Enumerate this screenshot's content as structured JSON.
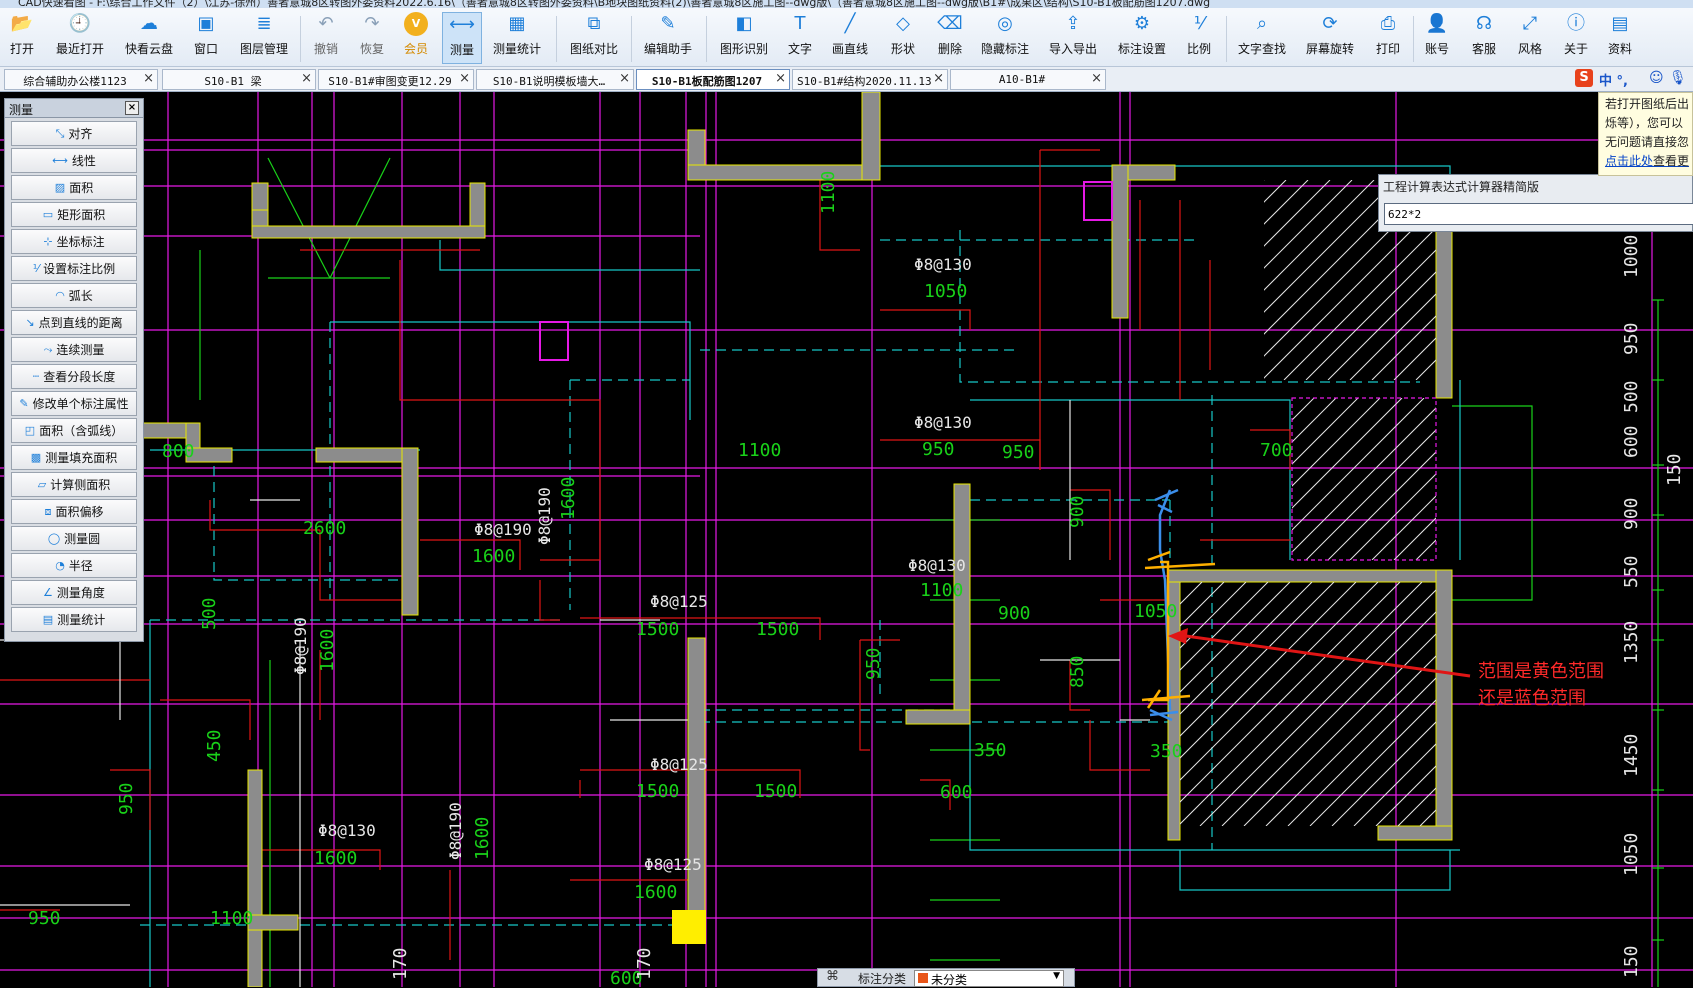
{
  "window_title": "CAD快速看图 - F:\\综合工作文件（2）\\江苏-徐州）善者意城8区转图外委资料2022.6.16\\（善者意城8区转图外委资料\\B地块图纸资料(2)\\善者意城8区施工图--dwg版\\（善者意城8区施工图--dwg版\\B1#\\成果区\\结构\\S10-B1板配筋图1207.dwg",
  "toolbar": [
    {
      "label": "打开",
      "icon": "open-folder-icon",
      "glyph": "📂"
    },
    {
      "label": "最近打开",
      "icon": "recent-clock-icon",
      "glyph": "🕘"
    },
    {
      "label": "快看云盘",
      "icon": "cloud-icon",
      "glyph": "☁"
    },
    {
      "label": "窗口",
      "icon": "window-icon",
      "glyph": "▣"
    },
    {
      "label": "图层管理",
      "icon": "layers-icon",
      "glyph": "≣"
    },
    {
      "label": "撤销",
      "icon": "undo-icon",
      "glyph": "↶"
    },
    {
      "label": "恢复",
      "icon": "redo-icon",
      "glyph": "↷"
    },
    {
      "label": "会员",
      "icon": "vip-badge-icon",
      "glyph": "V"
    },
    {
      "label": "测量",
      "icon": "measure-ruler-icon",
      "glyph": "⟷"
    },
    {
      "label": "测量统计",
      "icon": "measure-stats-icon",
      "glyph": "▦"
    },
    {
      "label": "图纸对比",
      "icon": "compare-icon",
      "glyph": "⧉"
    },
    {
      "label": "编辑助手",
      "icon": "edit-helper-icon",
      "glyph": "✎"
    },
    {
      "label": "图形识别",
      "icon": "shape-recognition-icon",
      "glyph": "◧"
    },
    {
      "label": "文字",
      "icon": "text-tool-icon",
      "glyph": "T"
    },
    {
      "label": "画直线",
      "icon": "line-tool-icon",
      "glyph": "╱"
    },
    {
      "label": "形状",
      "icon": "shape-tool-icon",
      "glyph": "◇"
    },
    {
      "label": "删除",
      "icon": "eraser-icon",
      "glyph": "⌫"
    },
    {
      "label": "隐藏标注",
      "icon": "hide-eye-icon",
      "glyph": "◎"
    },
    {
      "label": "导入导出",
      "icon": "import-export-icon",
      "glyph": "⇪"
    },
    {
      "label": "标注设置",
      "icon": "annotation-settings-icon",
      "glyph": "⚙"
    },
    {
      "label": "比例",
      "icon": "scale-icon",
      "glyph": "⅟"
    },
    {
      "label": "文字查找",
      "icon": "text-search-icon",
      "glyph": "⌕"
    },
    {
      "label": "屏幕旋转",
      "icon": "rotate-screen-icon",
      "glyph": "⟳"
    },
    {
      "label": "打印",
      "icon": "printer-icon",
      "glyph": "⎙"
    },
    {
      "label": "账号",
      "icon": "account-user-icon",
      "glyph": "👤"
    },
    {
      "label": "客服",
      "icon": "headset-icon",
      "glyph": "☊"
    },
    {
      "label": "风格",
      "icon": "style-icon",
      "glyph": "⤢"
    },
    {
      "label": "关于",
      "icon": "info-icon",
      "glyph": "ⓘ"
    },
    {
      "label": "资料",
      "icon": "documents-icon",
      "glyph": "▤"
    }
  ],
  "tabs": [
    {
      "label": "综合辅助办公楼1123"
    },
    {
      "label": "S10-B1 梁"
    },
    {
      "label": "S10-B1#审图变更12.29"
    },
    {
      "label": "S10-B1说明模板墙大…"
    },
    {
      "label": "S10-B1板配筋图1207"
    },
    {
      "label": "S10-B1#结构2020.11.13"
    },
    {
      "label": "A10-B1#"
    }
  ],
  "active_tab_index": 4,
  "tab_close_glyph": "×",
  "tray": {
    "ime_logo": "S",
    "ime_text": "中 °,",
    "icons": [
      "smile-icon",
      "mic-icon"
    ]
  },
  "measure_panel": {
    "title": "测量",
    "close_glyph": "×",
    "items": [
      {
        "label": "对齐",
        "icon": "align-measure-icon"
      },
      {
        "label": "线性",
        "icon": "linear-measure-icon"
      },
      {
        "label": "面积",
        "icon": "area-icon"
      },
      {
        "label": "矩形面积",
        "icon": "rect-area-icon"
      },
      {
        "label": "坐标标注",
        "icon": "coordinate-icon"
      },
      {
        "label": "设置标注比例",
        "icon": "set-scale-icon"
      },
      {
        "label": "弧长",
        "icon": "arc-length-icon"
      },
      {
        "label": "点到直线的距离",
        "icon": "point-line-distance-icon"
      },
      {
        "label": "连续测量",
        "icon": "continuous-measure-icon"
      },
      {
        "label": "查看分段长度",
        "icon": "segment-length-icon"
      },
      {
        "label": "修改单个标注属性",
        "icon": "edit-annotation-icon"
      },
      {
        "label": "面积（含弧线）",
        "icon": "area-arc-icon"
      },
      {
        "label": "测量填充面积",
        "icon": "fill-area-icon"
      },
      {
        "label": "计算侧面积",
        "icon": "side-area-icon"
      },
      {
        "label": "面积偏移",
        "icon": "area-offset-icon"
      },
      {
        "label": "测量圆",
        "icon": "circle-measure-icon"
      },
      {
        "label": "半径",
        "icon": "radius-icon"
      },
      {
        "label": "测量角度",
        "icon": "angle-icon"
      },
      {
        "label": "测量统计",
        "icon": "measure-stats-icon"
      }
    ]
  },
  "calculator": {
    "title": "工程计算表达式计算器精简版",
    "value": "622*2"
  },
  "notice": {
    "lines": [
      "若打开图纸后出",
      "烁等），您可以",
      "无问题请直接忽"
    ],
    "link": "点击此处",
    "link_suffix": "查看更"
  },
  "annotation": {
    "line1": "范围是黄色范围",
    "line2": "还是蓝色范围"
  },
  "bottom_bar": {
    "label": "标注分类",
    "value": "未分类"
  },
  "colors": {
    "green": "#19d119",
    "magenta": "#e619e6",
    "cyan": "#17c7c7",
    "red": "#e01515",
    "yellow": "#e8e800",
    "blue": "#3b8eea",
    "orange": "#ffb000",
    "wall_fill": "#8c8c8c",
    "white": "#e6e6e6"
  },
  "cad_labels": [
    "1100",
    "Φ8@130",
    "1050",
    "Φ8@130",
    "950",
    "950",
    "1100",
    "700",
    "800",
    "2600",
    "Φ8@190",
    "1600",
    "Φ8@190",
    "1600",
    "Φ8@130",
    "1100",
    "900",
    "900",
    "1050",
    "Φ8@125",
    "1500",
    "1500",
    "500",
    "Φ8@190",
    "1600",
    "950",
    "850",
    "450",
    "350",
    "350",
    "Φ8@125",
    "1500",
    "1500",
    "600",
    "950",
    "Φ8@130",
    "1600",
    "Φ8@190",
    "1600",
    "Φ8@125",
    "1600",
    "950",
    "1100",
    "170",
    "600",
    "170",
    "1000",
    "950",
    "500",
    "600",
    "900",
    "550",
    "1350",
    "1450",
    "1050",
    "150",
    "150"
  ]
}
